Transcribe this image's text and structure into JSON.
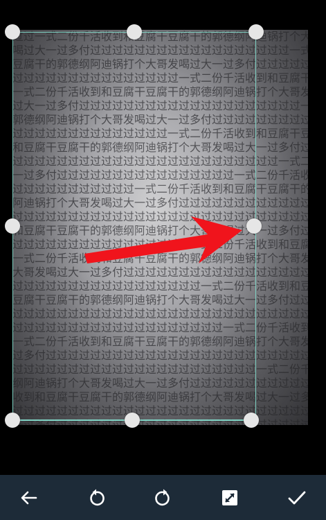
{
  "image": {
    "text_rows": [
      "过过一式二份千活收到和豆腐干豆腐干的郭德纲阿迪锅打个大哥发",
      "喝过大一过多付过过过过过过过过过过过过过过过过过过一式二份千",
      "豆腐干的郭德纲阿迪锅打个大哥发喝过大一过多付过过过过过过过过",
      "过过过过过过过过过过过过过过过一式二份千活收到和豆腐干豆腐干",
      "一式二份千活收到和豆腐干豆腐干的郭德纲阿迪锅打个大哥发喝过大",
      "过大一过多付过过过过过过过过过过过过过过过过过过过过一式二份千",
      "郭德纲阿迪锅打个大哥发喝过大一过多付过过过过过过过过过过过过",
      "过过过过过过过过过过过过过过一式二份千活收到和豆腐干豆腐干的",
      "和豆腐干豆腐干的郭德纲阿迪锅打个大哥发喝过大一过多付过过过过",
      "过过过过过过过过过过过过过过过过过过过过过过过过一式二份千活收",
      "一过多付过过过过过过过过过过过过过过过过一式二份千活收到和豆腐",
      "过过过过过过过过过过过一式二份千活收到和豆腐干豆腐干的郭德纲",
      "阿迪锅打个大哥发喝过大一过多付过过过过过过过过过过过过过过过",
      "过过过过过过过过过过过过过过过过过过过过过过过过过过过过过过一",
      "和豆腐干豆腐干的郭德纲阿迪锅打个大哥发喝过大一过多付过过过过",
      "过过过过过过过过过过过过过过过过一式二份千活收到和豆腐干豆腐干",
      "一式二份千活收到和豆腐干豆腐干的郭德纲阿迪锅打个大哥发喝过大",
      "大哥发喝过大一过多付过过过过过过过过过过过过过过过过过过过过",
      "过过过过过过过过过过过过过过过过过一式二份千活收到和豆腐干豆腐",
      "豆腐干豆腐干的郭德纲阿迪锅打个大哥发喝过大一过多付过过过过过",
      "过过过过过过过过过过过过过过过过过过过过过过过过过过过过过过过",
      "过过过过过过过过过过过过过过过过过过过一式二份千活收到和豆腐干",
      "一式二份千活收到和豆腐干豆腐干的郭德纲阿迪锅打个大哥发喝过大",
      "过多付过过过过过过过过过过过过过过过过过过过过过过过过过过过过",
      "过过过过过过过过过过过过过过过过过过过过过过一式二份千活收到和",
      "纲阿迪锅打个大哥发喝过大一过多付过过过过过过过过过过过过过过",
      "收到和豆腐干豆腐干的郭德纲阿迪锅打个大哥发喝过大一过多付过过",
      "过过过过过过过过过过过过过过过过过过过过过过过过过过过过过过",
      "一过多付过过过过过过过过过过过过过过过过过过过过过过过过过过"
    ]
  },
  "crop": {
    "frame_color": "#7fd3c4",
    "handle_color": "#e6e6e6"
  },
  "annotation": {
    "arrow_color": "#f0141c"
  },
  "toolbar": {
    "background": "#1d2b38",
    "buttons": [
      {
        "name": "back",
        "icon": "arrow-left-icon"
      },
      {
        "name": "rotate-left",
        "icon": "rotate-ccw-icon"
      },
      {
        "name": "rotate-right",
        "icon": "rotate-cw-icon"
      },
      {
        "name": "full-crop",
        "icon": "expand-diagonal-icon"
      },
      {
        "name": "confirm",
        "icon": "checkmark-icon"
      }
    ]
  }
}
